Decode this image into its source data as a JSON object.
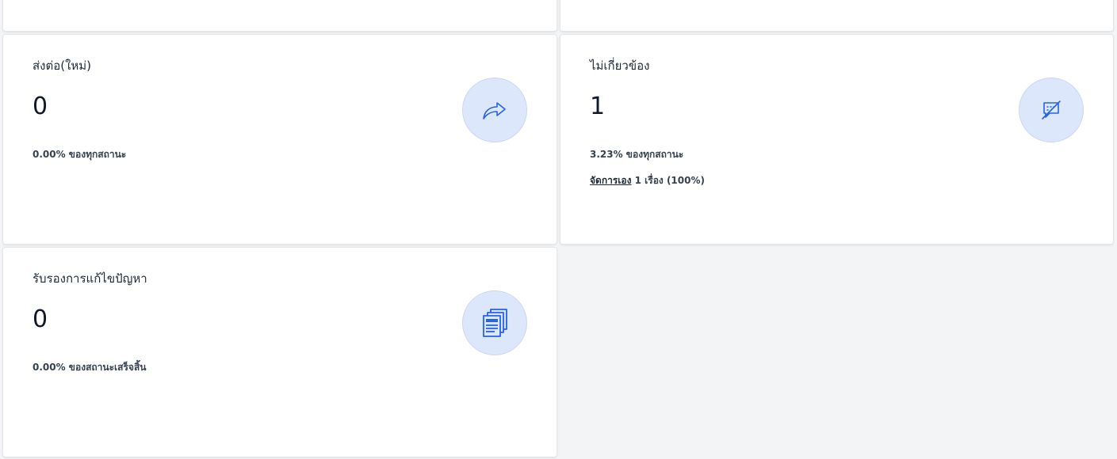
{
  "colors": {
    "accent": "#2563eb",
    "icon_bg": "#dde7fb",
    "card_border": "#e5e7eb"
  },
  "cards": [
    {
      "title": "ส่งต่อ(ใหม่)",
      "value": "0",
      "percent_text": "0.00% ของทุกสถานะ",
      "icon": "forward-arrow-icon"
    },
    {
      "title": "ไม่เกี่ยวข้อง",
      "value": "1",
      "percent_text": "3.23% ของทุกสถานะ",
      "detail_link": "จัดการเอง",
      "detail_text": " 1 เรื่อง (100%)",
      "icon": "comment-off-icon"
    },
    {
      "title": "รับรองการแก้ไขปัญหา",
      "value": "0",
      "percent_text": "0.00% ของสถานะเสร็จสิ้น",
      "icon": "documents-icon"
    }
  ]
}
